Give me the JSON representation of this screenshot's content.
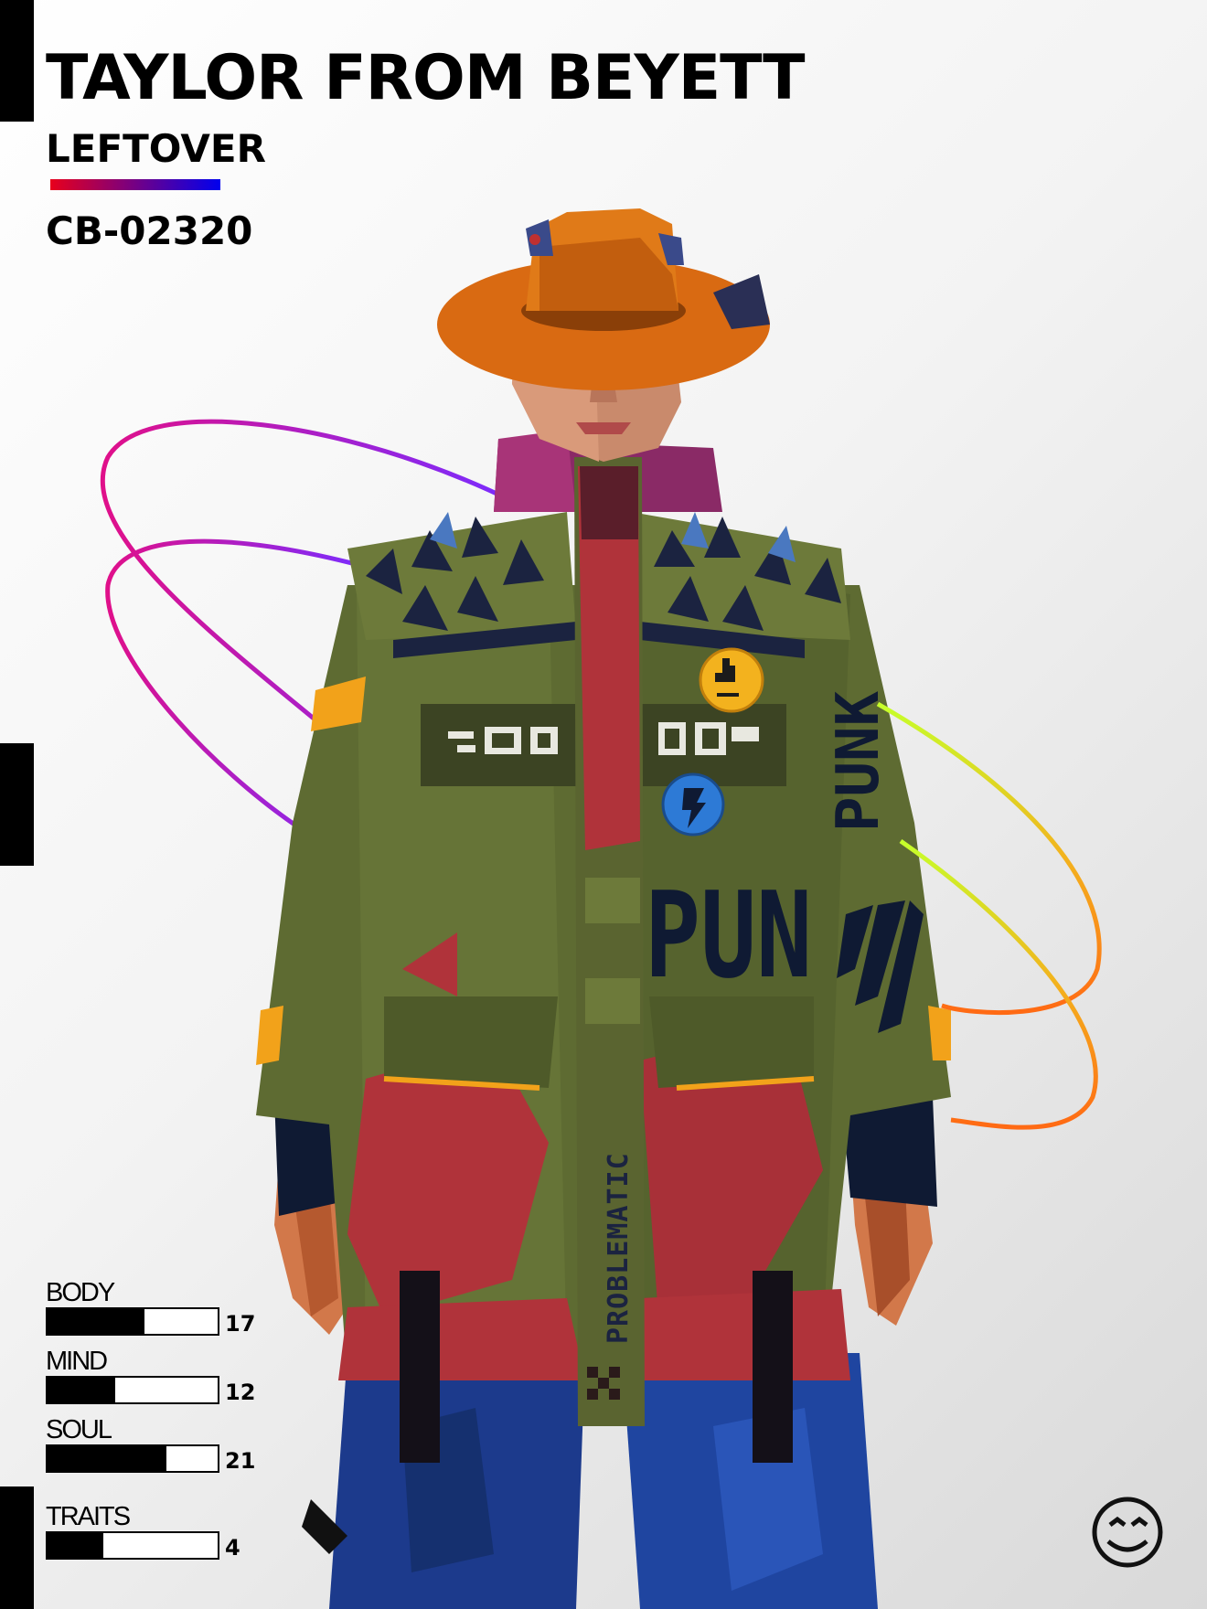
{
  "card": {
    "name": "TAYLOR FROM BEYETT",
    "class": "LEFTOVER",
    "id_code": "CB-02320"
  },
  "jacket": {
    "vertical_print": "PROBLEMATIC",
    "chest_print": "PUN",
    "sleeve_print": "PUNK"
  },
  "stats": [
    {
      "label": "BODY",
      "value": "17",
      "level": 0.57
    },
    {
      "label": "MIND",
      "value": "12",
      "level": 0.4
    },
    {
      "label": "SOUL",
      "value": "21",
      "level": 0.7
    },
    {
      "label": "TRAITS",
      "value": "4",
      "level": 0.33
    }
  ],
  "colors": {
    "accent_start": "#e8001c",
    "accent_end": "#0000ee",
    "hat": "#d96a12",
    "jacket": "#5e6b32",
    "stripe": "#b0333a",
    "pants": "#1c3a8c",
    "ring_left": "#c2188f",
    "ring_right": "#f07a1a"
  },
  "icons": {
    "logo": "smiley-logo-icon",
    "button_top": "hand-badge-icon",
    "button_bottom": "bolt-badge-icon"
  }
}
